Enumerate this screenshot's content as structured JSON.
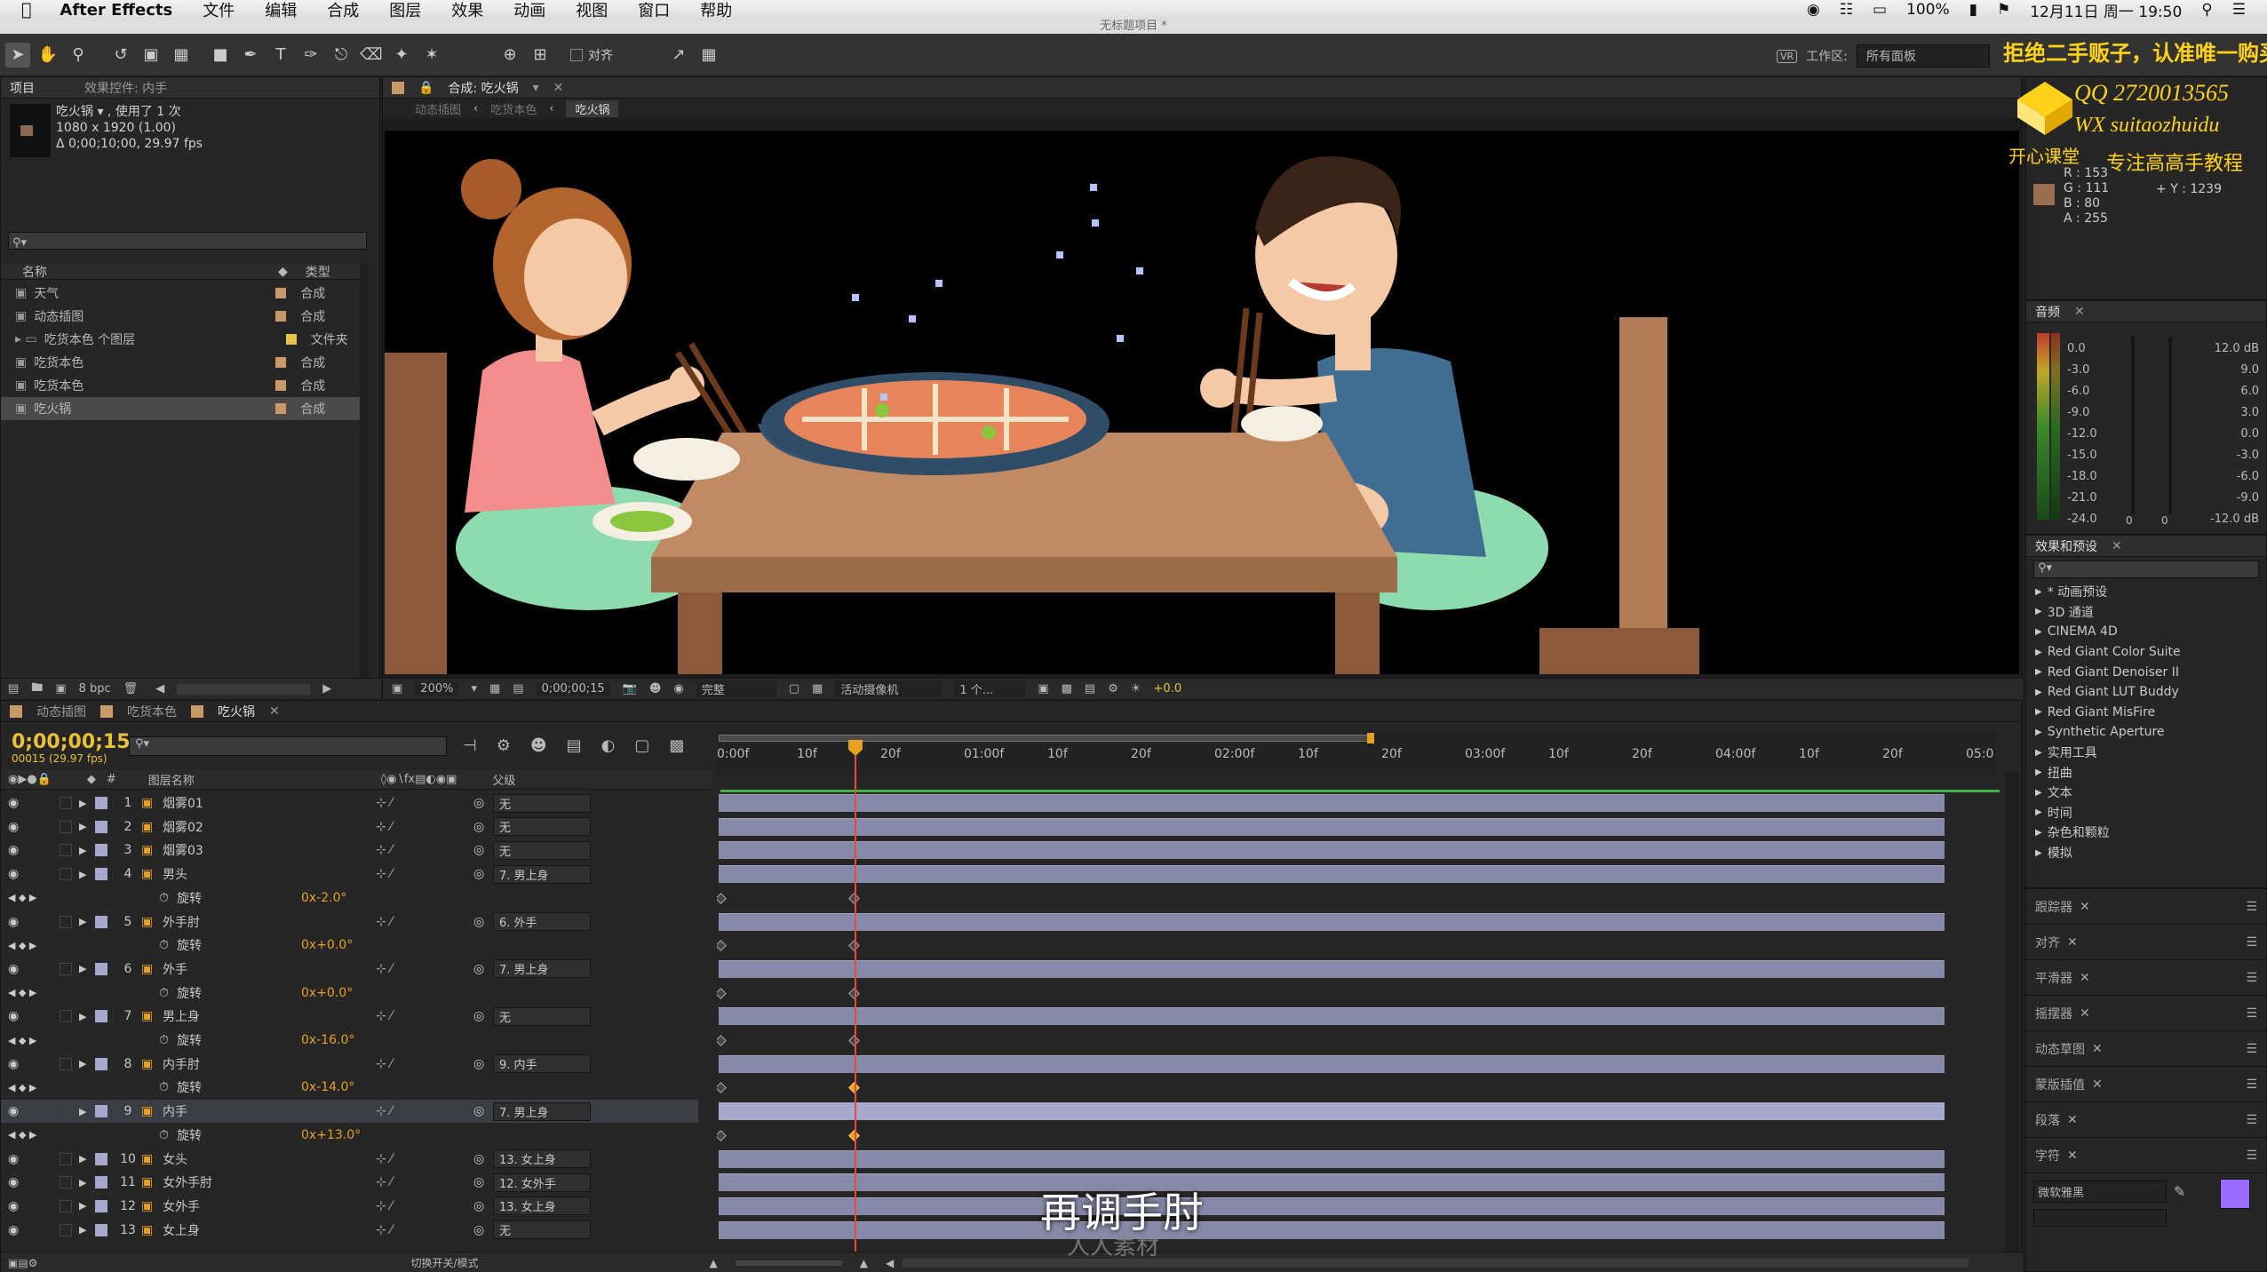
{
  "menubar": {
    "app_name": "After Effects",
    "items": [
      "文件",
      "编辑",
      "合成",
      "图层",
      "效果",
      "动画",
      "视图",
      "窗口",
      "帮助"
    ],
    "battery": "100%",
    "datetime": "12月11日 周一 19:50"
  },
  "window_title": "无标题项目 *",
  "toolbar": {
    "align_label": "对齐",
    "workspace_label": "工作区:",
    "workspace_value": "所有面板"
  },
  "watermark": {
    "line1": "拒绝二手贩子，认准唯一购买渠道",
    "qq": "QQ 2720013565",
    "wx": "WX suitaozhuidu",
    "brand": "开心课堂",
    "slogan": "专注高高手教程",
    "bottom": "人人素材"
  },
  "info_panel": {
    "r": "R : 153",
    "g": "G : 111",
    "b": "B : 80",
    "a": "A : 255",
    "y": "Y : 1239",
    "swatch": "#996f50"
  },
  "project_panel": {
    "tabs": [
      "项目",
      "效果控件: 内手"
    ],
    "item_title": "吃火锅 ▾ , 使用了 1 次",
    "item_size": "1080 x 1920 (1.00)",
    "item_duration": "Δ 0;00;10;00, 29.97 fps",
    "search_placeholder": "",
    "col_name": "名称",
    "col_type": "类型",
    "items": [
      {
        "name": "天气",
        "type": "合成",
        "color": "#c89a6a"
      },
      {
        "name": "动态插图",
        "type": "合成",
        "color": "#c89a6a"
      },
      {
        "name": "吃货本色 个图层",
        "type": "文件夹",
        "color": "#e6c44a"
      },
      {
        "name": "吃货本色",
        "type": "合成",
        "color": "#c89a6a"
      },
      {
        "name": "吃货本色",
        "type": "合成",
        "color": "#c89a6a"
      },
      {
        "name": "吃火锅",
        "type": "合成",
        "color": "#c89a6a"
      }
    ],
    "bpc": "8 bpc"
  },
  "comp_panel": {
    "tab_label": "合成: 吃火锅",
    "breadcrumbs": [
      "动态插图",
      "吃货本色",
      "吃火锅"
    ],
    "zoom": "200%",
    "timecode": "0;00;00;15",
    "resolution": "完整",
    "camera": "活动摄像机",
    "views": "1 个...",
    "exposure": "+0.0"
  },
  "timeline": {
    "tabs": [
      "动态插图",
      "吃货本色",
      "吃火锅"
    ],
    "timecode": "0;00;00;15",
    "frame_info": "00015 (29.97 fps)",
    "col_layer_name": "图层名称",
    "col_parent": "父级",
    "ruler": [
      "0:00f",
      "10f",
      "20f",
      "01:00f",
      "10f",
      "20f",
      "02:00f",
      "10f",
      "20f",
      "03:00f",
      "10f",
      "20f",
      "04:00f",
      "10f",
      "20f",
      "05:0"
    ],
    "layers": [
      {
        "num": "1",
        "name": "烟雾01",
        "parent": "无",
        "kind": "layer"
      },
      {
        "num": "2",
        "name": "烟雾02",
        "parent": "无",
        "kind": "layer"
      },
      {
        "num": "3",
        "name": "烟雾03",
        "parent": "无",
        "kind": "layer"
      },
      {
        "num": "4",
        "name": "男头",
        "parent": "7. 男上身",
        "kind": "layer"
      },
      {
        "num": "",
        "name": "旋转",
        "value": "0x-2.0°",
        "kind": "prop"
      },
      {
        "num": "5",
        "name": "外手肘",
        "parent": "6. 外手",
        "kind": "layer"
      },
      {
        "num": "",
        "name": "旋转",
        "value": "0x+0.0°",
        "kind": "prop"
      },
      {
        "num": "6",
        "name": "外手",
        "parent": "7. 男上身",
        "kind": "layer"
      },
      {
        "num": "",
        "name": "旋转",
        "value": "0x+0.0°",
        "kind": "prop"
      },
      {
        "num": "7",
        "name": "男上身",
        "parent": "无",
        "kind": "layer"
      },
      {
        "num": "",
        "name": "旋转",
        "value": "0x-16.0°",
        "kind": "prop"
      },
      {
        "num": "8",
        "name": "内手肘",
        "parent": "9. 内手",
        "kind": "layer"
      },
      {
        "num": "",
        "name": "旋转",
        "value": "0x-14.0°",
        "kind": "prop"
      },
      {
        "num": "9",
        "name": "内手",
        "parent": "7. 男上身",
        "kind": "layer"
      },
      {
        "num": "",
        "name": "旋转",
        "value": "0x+13.0°",
        "kind": "prop"
      },
      {
        "num": "10",
        "name": "女头",
        "parent": "13. 女上身",
        "kind": "layer"
      },
      {
        "num": "11",
        "name": "女外手肘",
        "parent": "12. 女外手",
        "kind": "layer"
      },
      {
        "num": "12",
        "name": "女外手",
        "parent": "13. 女上身",
        "kind": "layer"
      },
      {
        "num": "13",
        "name": "女上身",
        "parent": "无",
        "kind": "layer"
      }
    ],
    "toggle_label": "切换开关/模式",
    "caption": "再调手肘"
  },
  "audio_panel": {
    "tab": "音频",
    "left_scale": [
      "0.0",
      "-3.0",
      "-6.0",
      "-9.0",
      "-12.0",
      "-15.0",
      "-18.0",
      "-21.0",
      "-24.0"
    ],
    "right_scale": [
      "12.0 dB",
      "9.0",
      "6.0",
      "3.0",
      "0.0",
      "-3.0",
      "-6.0",
      "-9.0",
      "-12.0 dB"
    ],
    "zero_a": "0",
    "zero_b": "0"
  },
  "effects_panel": {
    "tab": "效果和预设",
    "items": [
      "* 动画预设",
      "3D 通道",
      "CINEMA 4D",
      "Red Giant Color Suite",
      "Red Giant Denoiser II",
      "Red Giant LUT Buddy",
      "Red Giant MisFire",
      "Synthetic Aperture",
      "实用工具",
      "扭曲",
      "文本",
      "时间",
      "杂色和颗粒",
      "模拟"
    ]
  },
  "mini_panels": [
    "跟踪器",
    "对齐",
    "平滑器",
    "摇摆器",
    "动态草图",
    "蒙版插值",
    "段落",
    "字符"
  ],
  "char_panel": {
    "font": "微软雅黑",
    "swatch": "#9b6bff"
  }
}
